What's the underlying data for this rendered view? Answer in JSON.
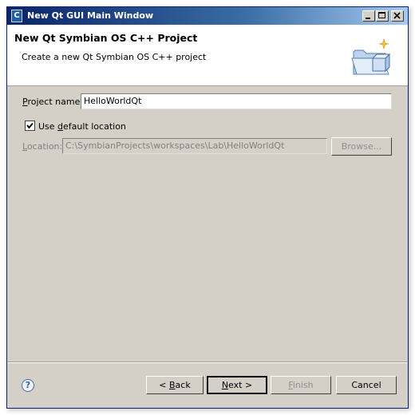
{
  "window": {
    "title": "New Qt GUI Main Window",
    "app_icon": "C"
  },
  "header": {
    "title": "New Qt Symbian OS C++ Project",
    "description": "Create a new Qt Symbian OS C++ project",
    "icon": "folder-wizard-icon"
  },
  "project_name": {
    "label_prefix": "",
    "label_mnemonic": "P",
    "label_rest": "roject name:",
    "value": "HelloWorldQt"
  },
  "default_location": {
    "checked": true,
    "label_before": "Use ",
    "label_mnemonic": "d",
    "label_after": "efault location"
  },
  "location": {
    "label_mnemonic": "L",
    "label_rest": "ocation:",
    "value": "C:\\SymbianProjects\\workspaces\\Lab\\HelloWorldQt",
    "browse_label": "Browse..."
  },
  "buttons": {
    "back_prefix": "< ",
    "back_mnemonic": "B",
    "back_rest": "ack",
    "next_mnemonic": "N",
    "next_rest": "ext >",
    "finish_mnemonic": "F",
    "finish_rest": "inish",
    "cancel_label": "Cancel"
  },
  "help": {
    "glyph": "?"
  },
  "colors": {
    "title_start": "#0a246a",
    "title_end": "#a6caf0",
    "dialog_bg": "#d4d0c8"
  }
}
